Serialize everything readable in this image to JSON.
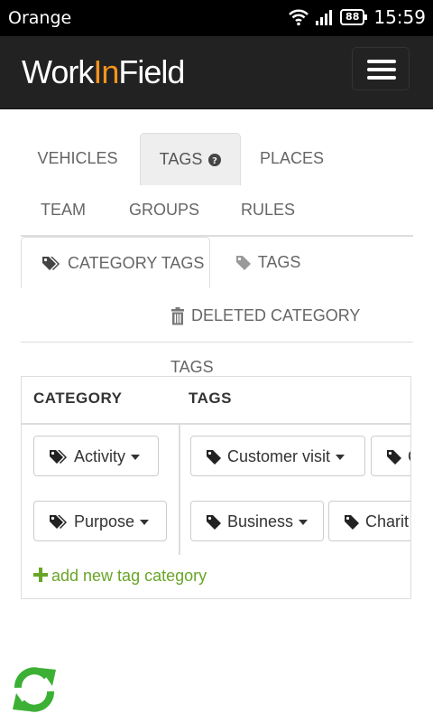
{
  "status_bar": {
    "carrier": "Orange",
    "battery": "88",
    "time": "15:59"
  },
  "navbar": {
    "brand_prefix": "Work",
    "brand_accent": "In",
    "brand_suffix": "Field"
  },
  "main_tabs": {
    "vehicles": "VEHICLES",
    "tags": "TAGS",
    "places": "PLACES",
    "team": "TEAM",
    "groups": "GROUPS",
    "rules": "RULES"
  },
  "sub_tabs": {
    "category_tags": "CATEGORY TAGS",
    "tags": "TAGS",
    "deleted_category_tags": "DELETED CATEGORY TAGS"
  },
  "table": {
    "headers": {
      "category": "CATEGORY",
      "tags": "TAGS"
    },
    "rows": [
      {
        "category": "Activity",
        "tags": [
          "Customer visit",
          "C"
        ]
      },
      {
        "category": "Purpose",
        "tags": [
          "Business",
          "Charit"
        ]
      }
    ]
  },
  "add_category_label": "add new tag category",
  "colors": {
    "brand_accent": "#f7941d",
    "link_green": "#69a527",
    "refresh_green": "#3cb034",
    "navbar_bg": "#222222"
  },
  "icons": {
    "tag": "tag-icon",
    "tags": "tags-icon",
    "trash": "trash-icon",
    "plus": "plus-icon",
    "refresh": "refresh-icon",
    "menu": "hamburger-menu-icon",
    "help": "question-circle-icon"
  }
}
